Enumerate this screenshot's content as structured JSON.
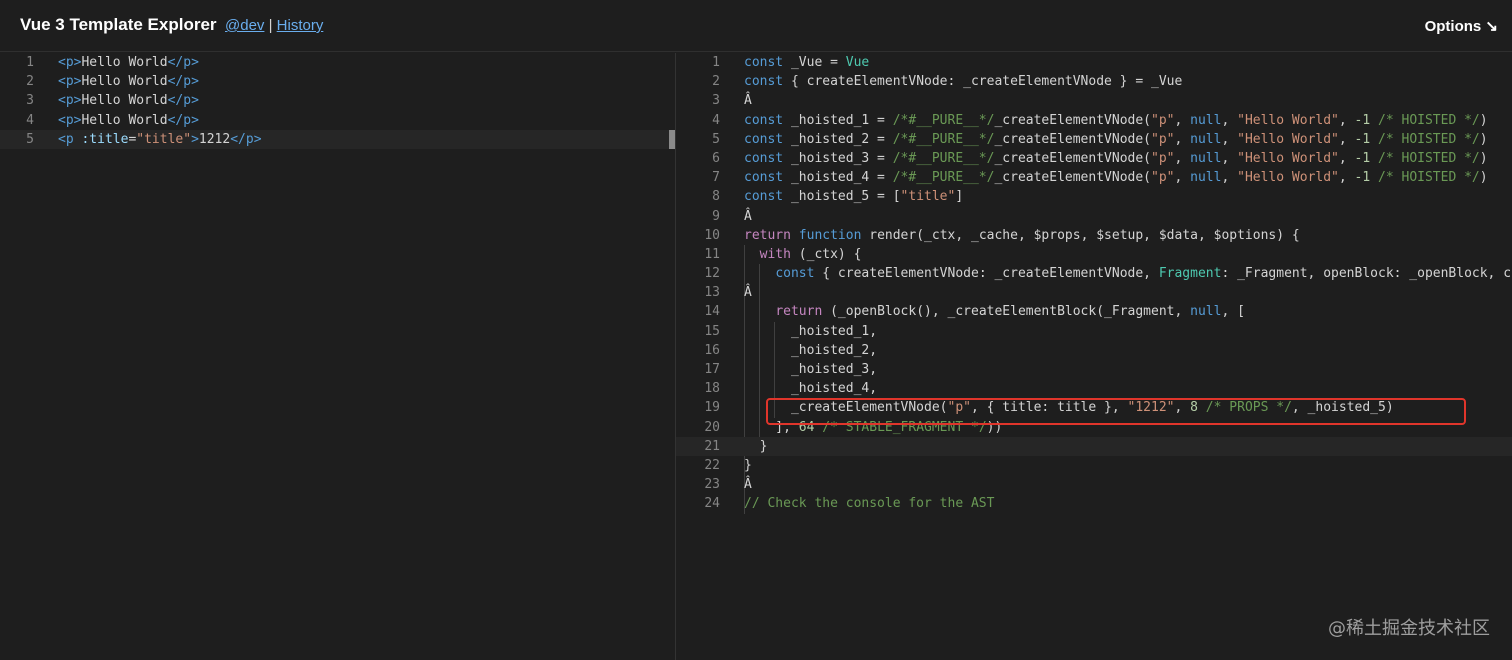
{
  "header": {
    "title": "Vue 3 Template Explorer",
    "dev_link": "@dev",
    "separator": "|",
    "history_link": "History",
    "options_label": "Options ↘"
  },
  "template_editor": {
    "lines": [
      {
        "num": "1",
        "parts": [
          [
            "tag",
            "<"
          ],
          [
            "tag",
            "p"
          ],
          [
            "tag",
            ">"
          ],
          [
            "id",
            "Hello World"
          ],
          [
            "tag",
            "</"
          ],
          [
            "tag",
            "p"
          ],
          [
            "tag",
            ">"
          ]
        ]
      },
      {
        "num": "2",
        "parts": [
          [
            "tag",
            "<"
          ],
          [
            "tag",
            "p"
          ],
          [
            "tag",
            ">"
          ],
          [
            "id",
            "Hello World"
          ],
          [
            "tag",
            "</"
          ],
          [
            "tag",
            "p"
          ],
          [
            "tag",
            ">"
          ]
        ]
      },
      {
        "num": "3",
        "parts": [
          [
            "tag",
            "<"
          ],
          [
            "tag",
            "p"
          ],
          [
            "tag",
            ">"
          ],
          [
            "id",
            "Hello World"
          ],
          [
            "tag",
            "</"
          ],
          [
            "tag",
            "p"
          ],
          [
            "tag",
            ">"
          ]
        ]
      },
      {
        "num": "4",
        "parts": [
          [
            "tag",
            "<"
          ],
          [
            "tag",
            "p"
          ],
          [
            "tag",
            ">"
          ],
          [
            "id",
            "Hello World"
          ],
          [
            "tag",
            "</"
          ],
          [
            "tag",
            "p"
          ],
          [
            "tag",
            ">"
          ]
        ]
      },
      {
        "num": "5",
        "parts": [
          [
            "tag",
            "<"
          ],
          [
            "tag",
            "p "
          ],
          [
            "attr",
            ":title"
          ],
          [
            "id",
            "="
          ],
          [
            "str",
            "\"title\""
          ],
          [
            "tag",
            ">"
          ],
          [
            "id",
            "1212"
          ],
          [
            "tag",
            "</"
          ],
          [
            "tag",
            "p"
          ],
          [
            "tag",
            ">"
          ]
        ]
      }
    ]
  },
  "output_editor": {
    "lines": [
      {
        "num": "1",
        "parts": [
          [
            "kw2",
            "const"
          ],
          [
            "id",
            " _Vue = "
          ],
          [
            "ty",
            "Vue"
          ]
        ]
      },
      {
        "num": "2",
        "parts": [
          [
            "kw2",
            "const"
          ],
          [
            "id",
            " { createElementVNode: _createElementVNode } = _Vue"
          ]
        ]
      },
      {
        "num": "3",
        "parts": [
          [
            "id",
            "Â"
          ]
        ]
      },
      {
        "num": "4",
        "parts": [
          [
            "kw2",
            "const"
          ],
          [
            "id",
            " _hoisted_1 = "
          ],
          [
            "cmt",
            "/*#__PURE__*/"
          ],
          [
            "id",
            "_createElementVNode("
          ],
          [
            "str",
            "\"p\""
          ],
          [
            "id",
            ", "
          ],
          [
            "kw2",
            "null"
          ],
          [
            "id",
            ", "
          ],
          [
            "str",
            "\"Hello World\""
          ],
          [
            "id",
            ", "
          ],
          [
            "num",
            "-1"
          ],
          [
            "cmt",
            " /* HOISTED */"
          ],
          [
            "id",
            ")"
          ]
        ]
      },
      {
        "num": "5",
        "parts": [
          [
            "kw2",
            "const"
          ],
          [
            "id",
            " _hoisted_2 = "
          ],
          [
            "cmt",
            "/*#__PURE__*/"
          ],
          [
            "id",
            "_createElementVNode("
          ],
          [
            "str",
            "\"p\""
          ],
          [
            "id",
            ", "
          ],
          [
            "kw2",
            "null"
          ],
          [
            "id",
            ", "
          ],
          [
            "str",
            "\"Hello World\""
          ],
          [
            "id",
            ", "
          ],
          [
            "num",
            "-1"
          ],
          [
            "cmt",
            " /* HOISTED */"
          ],
          [
            "id",
            ")"
          ]
        ]
      },
      {
        "num": "6",
        "parts": [
          [
            "kw2",
            "const"
          ],
          [
            "id",
            " _hoisted_3 = "
          ],
          [
            "cmt",
            "/*#__PURE__*/"
          ],
          [
            "id",
            "_createElementVNode("
          ],
          [
            "str",
            "\"p\""
          ],
          [
            "id",
            ", "
          ],
          [
            "kw2",
            "null"
          ],
          [
            "id",
            ", "
          ],
          [
            "str",
            "\"Hello World\""
          ],
          [
            "id",
            ", "
          ],
          [
            "num",
            "-1"
          ],
          [
            "cmt",
            " /* HOISTED */"
          ],
          [
            "id",
            ")"
          ]
        ]
      },
      {
        "num": "7",
        "parts": [
          [
            "kw2",
            "const"
          ],
          [
            "id",
            " _hoisted_4 = "
          ],
          [
            "cmt",
            "/*#__PURE__*/"
          ],
          [
            "id",
            "_createElementVNode("
          ],
          [
            "str",
            "\"p\""
          ],
          [
            "id",
            ", "
          ],
          [
            "kw2",
            "null"
          ],
          [
            "id",
            ", "
          ],
          [
            "str",
            "\"Hello World\""
          ],
          [
            "id",
            ", "
          ],
          [
            "num",
            "-1"
          ],
          [
            "cmt",
            " /* HOISTED */"
          ],
          [
            "id",
            ")"
          ]
        ]
      },
      {
        "num": "8",
        "parts": [
          [
            "kw2",
            "const"
          ],
          [
            "id",
            " _hoisted_5 = ["
          ],
          [
            "str",
            "\"title\""
          ],
          [
            "id",
            "]"
          ]
        ]
      },
      {
        "num": "9",
        "parts": [
          [
            "id",
            "Â"
          ]
        ]
      },
      {
        "num": "10",
        "parts": [
          [
            "kw",
            "return"
          ],
          [
            "id",
            " "
          ],
          [
            "kw2",
            "function"
          ],
          [
            "id",
            " render(_ctx, _cache, $props, $setup, $data, $options) {"
          ]
        ]
      },
      {
        "num": "11",
        "parts": [
          [
            "id",
            "  "
          ],
          [
            "kw",
            "with"
          ],
          [
            "id",
            " (_ctx) {"
          ]
        ]
      },
      {
        "num": "12",
        "parts": [
          [
            "id",
            "    "
          ],
          [
            "kw2",
            "const"
          ],
          [
            "id",
            " { createElementVNode: _createElementVNode, "
          ],
          [
            "ty",
            "Fragment"
          ],
          [
            "id",
            ": _Fragment, openBlock: _openBlock, createElementBlock: _createElementBlock } = _Vue"
          ]
        ]
      },
      {
        "num": "13",
        "parts": [
          [
            "id",
            "Â"
          ]
        ]
      },
      {
        "num": "14",
        "parts": [
          [
            "id",
            "    "
          ],
          [
            "kw",
            "return"
          ],
          [
            "id",
            " (_openBlock(), _createElementBlock(_Fragment, "
          ],
          [
            "kw2",
            "null"
          ],
          [
            "id",
            ", ["
          ]
        ]
      },
      {
        "num": "15",
        "parts": [
          [
            "id",
            "      _hoisted_1,"
          ]
        ]
      },
      {
        "num": "16",
        "parts": [
          [
            "id",
            "      _hoisted_2,"
          ]
        ]
      },
      {
        "num": "17",
        "parts": [
          [
            "id",
            "      _hoisted_3,"
          ]
        ]
      },
      {
        "num": "18",
        "parts": [
          [
            "id",
            "      _hoisted_4,"
          ]
        ]
      },
      {
        "num": "19",
        "parts": [
          [
            "id",
            "      _createElementVNode("
          ],
          [
            "str",
            "\"p\""
          ],
          [
            "id",
            ", { title: title }, "
          ],
          [
            "str",
            "\"1212\""
          ],
          [
            "id",
            ", "
          ],
          [
            "num",
            "8"
          ],
          [
            "cmt",
            " /* PROPS */"
          ],
          [
            "id",
            ", _hoisted_5)"
          ]
        ]
      },
      {
        "num": "20",
        "parts": [
          [
            "id",
            "    ], "
          ],
          [
            "num",
            "64"
          ],
          [
            "cmt",
            " /* STABLE_FRAGMENT */"
          ],
          [
            "id",
            "))"
          ]
        ]
      },
      {
        "num": "21",
        "parts": [
          [
            "id",
            "  }"
          ]
        ]
      },
      {
        "num": "22",
        "parts": [
          [
            "id",
            "}"
          ]
        ]
      },
      {
        "num": "23",
        "parts": [
          [
            "id",
            "Â"
          ]
        ]
      },
      {
        "num": "24",
        "parts": [
          [
            "cmt",
            "// Check the console for the AST"
          ]
        ]
      }
    ]
  },
  "watermark": "@稀土掘金技术社区"
}
